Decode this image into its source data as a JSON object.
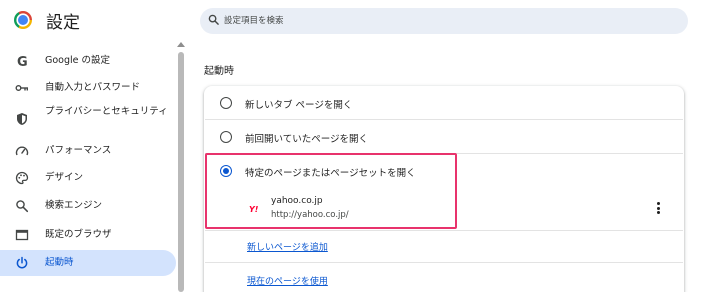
{
  "header": {
    "title": "設定",
    "search_placeholder": "設定項目を検索"
  },
  "sidebar": {
    "items": [
      {
        "label": "Google の設定",
        "icon": "google-icon"
      },
      {
        "label": "自動入力とパスワード",
        "icon": "key-icon"
      },
      {
        "label": "プライバシーとセキュリティ",
        "icon": "shield-icon"
      },
      {
        "label": "パフォーマンス",
        "icon": "speedometer-icon"
      },
      {
        "label": "デザイン",
        "icon": "palette-icon"
      },
      {
        "label": "検索エンジン",
        "icon": "search-icon"
      },
      {
        "label": "既定のブラウザ",
        "icon": "browser-window-icon"
      },
      {
        "label": "起動時",
        "icon": "power-icon",
        "active": true
      }
    ]
  },
  "main": {
    "section_title": "起動時",
    "options": [
      {
        "label": "新しいタブ ページを開く",
        "checked": false
      },
      {
        "label": "前回開いていたページを開く",
        "checked": false
      },
      {
        "label": "特定のページまたはページセットを開く",
        "checked": true
      }
    ],
    "site": {
      "favicon_text": "Y!",
      "name": "yahoo.co.jp",
      "url": "http://yahoo.co.jp/"
    },
    "links": {
      "add_page": "新しいページを追加",
      "use_current": "現在のページを使用"
    }
  },
  "colors": {
    "accent": "#0b57d0",
    "active_bg": "#d3e3fd",
    "highlight_border": "#e8336c",
    "search_bg": "#e9eef6"
  }
}
